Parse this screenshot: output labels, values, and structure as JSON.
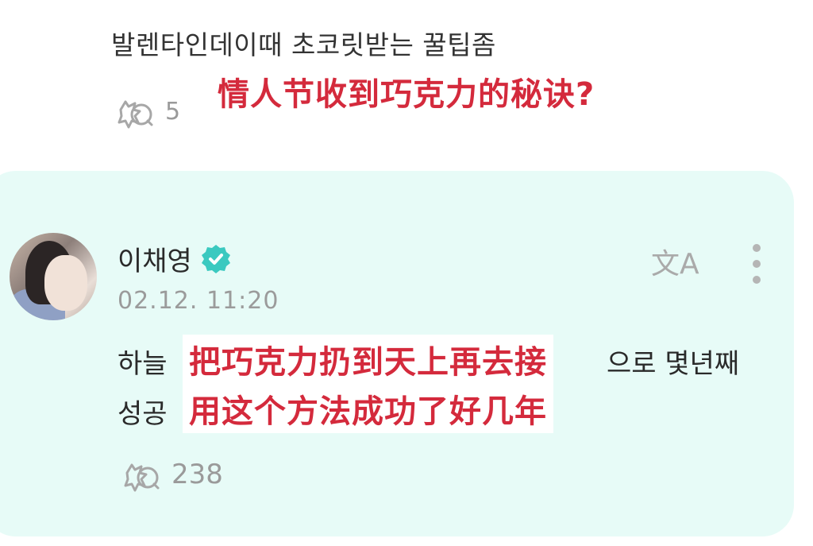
{
  "post": {
    "title": "발렌타인데이때 초코릿받는 꿀팁좀",
    "translation_overlay": "情人节收到巧克力的秘诀?",
    "reaction_count": "5"
  },
  "comment": {
    "author": "이채영",
    "verified": true,
    "timestamp": "02.12. 11:20",
    "translate_label": "文A",
    "line1_start": "하늘",
    "line1_end": "으로 몇년째",
    "line2_start": "성공",
    "overlay_line1": "把巧克力扔到天上再去接",
    "overlay_line2": "用这个方法成功了好几年",
    "reaction_count": "238"
  },
  "colors": {
    "overlay_red": "#d42a3c",
    "comment_bg": "#e7fbf7",
    "verified_badge": "#3bc9c0"
  },
  "icons": {
    "reaction": "reaction-icon",
    "verified": "verified-badge-icon",
    "translate": "translate-icon",
    "more": "more-vertical-icon"
  }
}
